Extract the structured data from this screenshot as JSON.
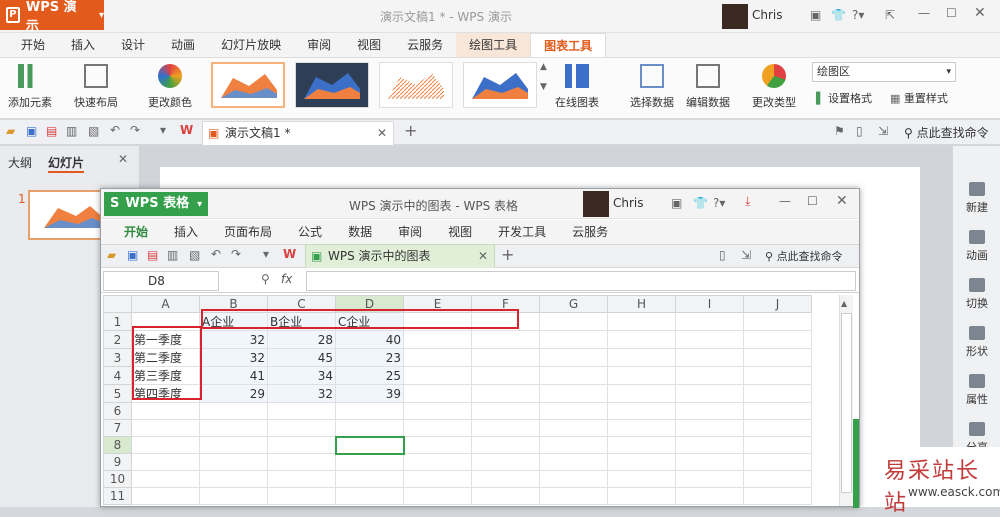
{
  "presentation": {
    "app_button": "WPS 演示",
    "window_title": "演示文稿1 * - WPS 演示",
    "user_name": "Chris",
    "tabs": [
      "开始",
      "插入",
      "设计",
      "动画",
      "幻灯片放映",
      "审阅",
      "视图",
      "云服务",
      "绘图工具",
      "图表工具"
    ],
    "active_tab": "图表工具",
    "ribbon": {
      "add_element": "添加元素",
      "quick_layout": "快速布局",
      "change_color": "更改颜色",
      "online_chart": "在线图表",
      "select_data": "选择数据",
      "edit_data": "编辑数据",
      "change_type": "更改类型",
      "chart_area_select": "绘图区",
      "format_settings": "设置格式",
      "reset_style": "重置样式"
    },
    "doc_tab": "演示文稿1 *",
    "search_cmd": "点此查找命令",
    "panel_tabs": [
      "大纲",
      "幻灯片"
    ],
    "slide_number": "1",
    "right_bar": [
      "新建",
      "动画",
      "切换",
      "形状",
      "属性",
      "分享"
    ],
    "colors": {
      "accent": "#e25a1c",
      "chart_tools_tab": "#e25a1c"
    }
  },
  "spreadsheet": {
    "app_button": "WPS 表格",
    "window_title": "WPS 演示中的图表 - WPS 表格",
    "user_name": "Chris",
    "tabs": [
      "开始",
      "插入",
      "页面布局",
      "公式",
      "数据",
      "审阅",
      "视图",
      "开发工具",
      "云服务"
    ],
    "active_tab": "开始",
    "doc_tab": "WPS 演示中的图表",
    "search_cmd": "点此查找命令",
    "name_box": "D8",
    "fx_label": "fx",
    "formula_value": "",
    "columns": [
      "A",
      "B",
      "C",
      "D",
      "E",
      "F",
      "G",
      "H",
      "I",
      "J"
    ],
    "rows": [
      [
        "",
        "A企业",
        "B企业",
        "C企业",
        "",
        "",
        "",
        "",
        "",
        ""
      ],
      [
        "第一季度",
        "32",
        "28",
        "40",
        "",
        "",
        "",
        "",
        "",
        ""
      ],
      [
        "第二季度",
        "32",
        "45",
        "23",
        "",
        "",
        "",
        "",
        "",
        ""
      ],
      [
        "第三季度",
        "41",
        "34",
        "25",
        "",
        "",
        "",
        "",
        "",
        ""
      ],
      [
        "第四季度",
        "29",
        "32",
        "39",
        "",
        "",
        "",
        "",
        "",
        ""
      ],
      [
        "",
        "",
        "",
        "",
        "",
        "",
        "",
        "",
        "",
        ""
      ],
      [
        "",
        "",
        "",
        "",
        "",
        "",
        "",
        "",
        "",
        ""
      ],
      [
        "",
        "",
        "",
        "",
        "",
        "",
        "",
        "",
        "",
        ""
      ],
      [
        "",
        "",
        "",
        "",
        "",
        "",
        "",
        "",
        "",
        ""
      ],
      [
        "",
        "",
        "",
        "",
        "",
        "",
        "",
        "",
        "",
        ""
      ],
      [
        "",
        "",
        "",
        "",
        "",
        "",
        "",
        "",
        "",
        ""
      ]
    ],
    "colors": {
      "accent": "#35a04b",
      "highlight": "#d9232e"
    }
  },
  "watermark": {
    "text1": "易采站长站",
    "text2": "www.easck.com"
  }
}
